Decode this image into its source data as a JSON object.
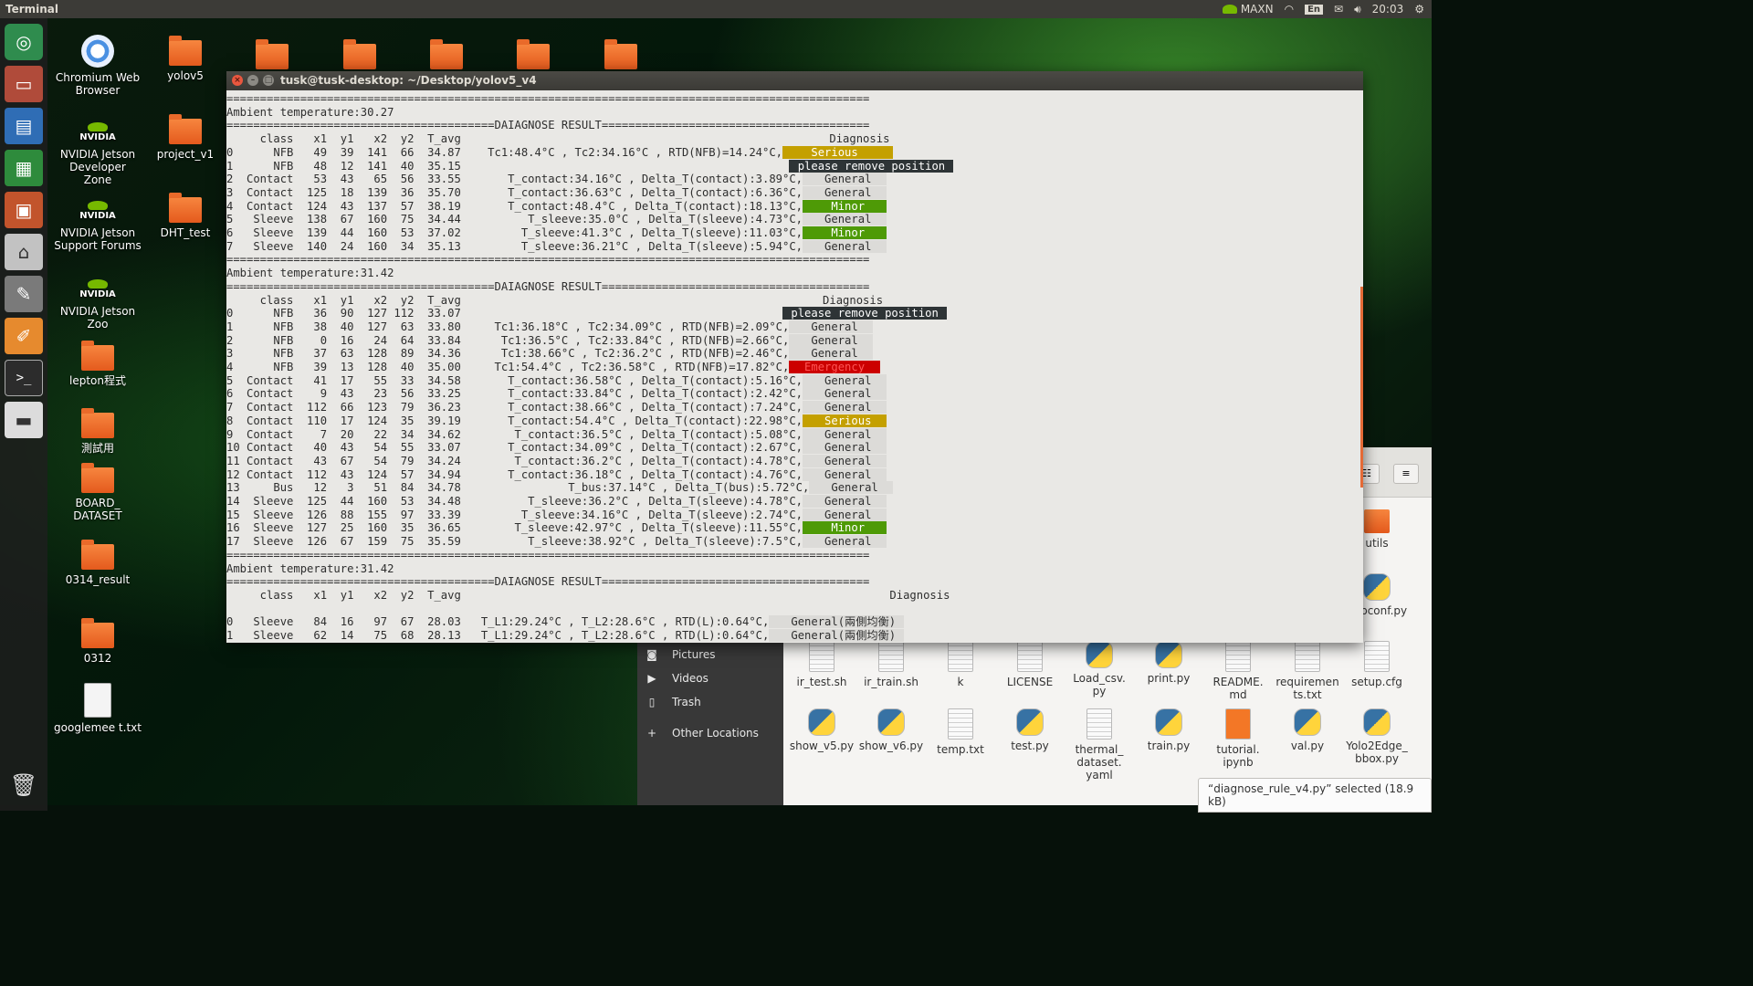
{
  "top_panel": {
    "app_title": "Terminal",
    "power_mode": "MAXN",
    "input_lang": "En",
    "clock": "20:03"
  },
  "launcher": {
    "items": [
      "ubuntu-logo",
      "files",
      "writer",
      "calc",
      "impress",
      "software-center",
      "settings",
      "text-editor",
      "terminal",
      "drive"
    ],
    "trash": "trash"
  },
  "desktop": {
    "icons": [
      {
        "label": "Chromium Web Browser",
        "kind": "chromium"
      },
      {
        "label": "yolov5",
        "kind": "folder"
      },
      {
        "label": "NVIDIA Jetson Developer Zone",
        "kind": "nvidia"
      },
      {
        "label": "project_v1",
        "kind": "folder"
      },
      {
        "label": "NVIDIA Jetson Support Forums",
        "kind": "nvidia"
      },
      {
        "label": "DHT_test",
        "kind": "folder"
      },
      {
        "label": "NVIDIA Jetson Zoo",
        "kind": "nvidia"
      },
      {
        "label": "lepton程式",
        "kind": "folder"
      },
      {
        "label": "測試用",
        "kind": "folder"
      },
      {
        "label": "BOARD_ DATASET",
        "kind": "folder"
      },
      {
        "label": "0314_result",
        "kind": "folder"
      },
      {
        "label": "0312",
        "kind": "folder"
      },
      {
        "label": "googlemee t.txt",
        "kind": "txt"
      }
    ]
  },
  "files_window": {
    "sidebar": [
      {
        "label": "Pictures",
        "icon": "camera-icon"
      },
      {
        "label": "Videos",
        "icon": "video-icon"
      },
      {
        "label": "Trash",
        "icon": "trash-icon"
      },
      {
        "label": "Other Locations",
        "icon": "plus-icon"
      }
    ],
    "items": [
      {
        "label": "utils",
        "type": "folder-sm"
      },
      {
        "label": "hubconf.py",
        "type": "py"
      },
      {
        "label": "ir_test.sh",
        "type": "txt"
      },
      {
        "label": "ir_train.sh",
        "type": "txt"
      },
      {
        "label": "k",
        "type": "txt"
      },
      {
        "label": "LICENSE",
        "type": "txt"
      },
      {
        "label": "Load_csv. py",
        "type": "py"
      },
      {
        "label": "print.py",
        "type": "py"
      },
      {
        "label": "README. md",
        "type": "txt"
      },
      {
        "label": "requiremen ts.txt",
        "type": "txt"
      },
      {
        "label": "setup.cfg",
        "type": "txt"
      },
      {
        "label": "show_v5.py",
        "type": "py"
      },
      {
        "label": "show_v6.py",
        "type": "py"
      },
      {
        "label": "temp.txt",
        "type": "txt"
      },
      {
        "label": "test.py",
        "type": "py"
      },
      {
        "label": "thermal_ dataset. yaml",
        "type": "txt"
      },
      {
        "label": "train.py",
        "type": "py"
      },
      {
        "label": "tutorial. ipynb",
        "type": "nb"
      },
      {
        "label": "val.py",
        "type": "py"
      },
      {
        "label": "Yolo2Edge_ bbox.py",
        "type": "py"
      }
    ],
    "status": "“diagnose_rule_v4.py” selected  (18.9 kB)"
  },
  "terminal": {
    "title": "tusk@tusk-desktop: ~/Desktop/yolov5_v4",
    "lines": [
      {
        "text": "================================================================================================"
      },
      {
        "text": "Ambient temperature:30.27"
      },
      {
        "text": "========================================DAIAGNOSE RESULT========================================"
      },
      {
        "text": "     class   x1  y1   x2  y2  T_avg                                                       Diagnosis"
      },
      {
        "text": "0      NFB   49  39  141  66  34.87    Tc1:48.4°C , Tc2:34.16°C , RTD(NFB)=14.24°C,",
        "tag": "    Serious     ",
        "tag_class": "serious"
      },
      {
        "text": "1      NFB   48  12  141  40  35.15                                                 ",
        "tag": " please remove position ",
        "tag_class": "note"
      },
      {
        "text": "2  Contact   53  43   65  56  33.55       T_contact:34.16°C , Delta_T(contact):3.89°C,",
        "tag": "   General  ",
        "tag_class": "general"
      },
      {
        "text": "3  Contact  125  18  139  36  35.70       T_contact:36.63°C , Delta_T(contact):6.36°C,",
        "tag": "   General  ",
        "tag_class": "general"
      },
      {
        "text": "4  Contact  124  43  137  57  38.19       T_contact:48.4°C , Delta_T(contact):18.13°C,",
        "tag": "    Minor   ",
        "tag_class": "minor"
      },
      {
        "text": "5   Sleeve  138  67  160  75  34.44          T_sleeve:35.0°C , Delta_T(sleeve):4.73°C,",
        "tag": "   General  ",
        "tag_class": "general"
      },
      {
        "text": "6   Sleeve  139  44  160  53  37.02         T_sleeve:41.3°C , Delta_T(sleeve):11.03°C,",
        "tag": "    Minor   ",
        "tag_class": "minor"
      },
      {
        "text": "7   Sleeve  140  24  160  34  35.13         T_sleeve:36.21°C , Delta_T(sleeve):5.94°C,",
        "tag": "   General  ",
        "tag_class": "general"
      },
      {
        "text": "================================================================================================"
      },
      {
        "text": "Ambient temperature:31.42"
      },
      {
        "text": "========================================DAIAGNOSE RESULT========================================"
      },
      {
        "text": "     class   x1  y1   x2  y2  T_avg                                                      Diagnosis"
      },
      {
        "text": "0      NFB   36  90  127 112  33.07                                                ",
        "tag": " please remove position ",
        "tag_class": "note"
      },
      {
        "text": "1      NFB   38  40  127  63  33.80     Tc1:36.18°C , Tc2:34.09°C , RTD(NFB)=2.09°C,",
        "tag": "   General  ",
        "tag_class": "general"
      },
      {
        "text": "2      NFB    0  16   24  64  33.84      Tc1:36.5°C , Tc2:33.84°C , RTD(NFB)=2.66°C,",
        "tag": "   General  ",
        "tag_class": "general"
      },
      {
        "text": "3      NFB   37  63  128  89  34.36      Tc1:38.66°C , Tc2:36.2°C , RTD(NFB)=2.46°C,",
        "tag": "   General  ",
        "tag_class": "general"
      },
      {
        "text": "4      NFB   39  13  128  40  35.00     Tc1:54.4°C , Tc2:36.58°C , RTD(NFB)=17.82°C,",
        "tag": "  Emergency  ",
        "tag_class": "emergency"
      },
      {
        "text": "5  Contact   41  17   55  33  34.58       T_contact:36.58°C , Delta_T(contact):5.16°C,",
        "tag": "   General  ",
        "tag_class": "general"
      },
      {
        "text": "6  Contact    9  43   23  56  33.25       T_contact:33.84°C , Delta_T(contact):2.42°C,",
        "tag": "   General  ",
        "tag_class": "general"
      },
      {
        "text": "7  Contact  112  66  123  79  36.23       T_contact:38.66°C , Delta_T(contact):7.24°C,",
        "tag": "   General  ",
        "tag_class": "general"
      },
      {
        "text": "8  Contact  110  17  124  35  39.19       T_contact:54.4°C , Delta_T(contact):22.98°C,",
        "tag": "   Serious  ",
        "tag_class": "serious"
      },
      {
        "text": "9  Contact    7  20   22  34  34.62        T_contact:36.5°C , Delta_T(contact):5.08°C,",
        "tag": "   General  ",
        "tag_class": "general"
      },
      {
        "text": "10 Contact   40  43   54  55  33.07       T_contact:34.09°C , Delta_T(contact):2.67°C,",
        "tag": "   General  ",
        "tag_class": "general"
      },
      {
        "text": "11 Contact   43  67   54  79  34.24        T_contact:36.2°C , Delta_T(contact):4.78°C,",
        "tag": "   General  ",
        "tag_class": "general"
      },
      {
        "text": "12 Contact  112  43  124  57  34.94       T_contact:36.18°C , Delta_T(contact):4.76°C,",
        "tag": "   General  ",
        "tag_class": "general"
      },
      {
        "text": "13     Bus   12   3   51  84  34.78                T_bus:37.14°C , Delta_T(bus):5.72°C,",
        "tag": "   General  ",
        "tag_class": "general"
      },
      {
        "text": "14  Sleeve  125  44  160  53  34.48          T_sleeve:36.2°C , Delta_T(sleeve):4.78°C,",
        "tag": "   General  ",
        "tag_class": "general"
      },
      {
        "text": "15  Sleeve  126  88  155  97  33.39         T_sleeve:34.16°C , Delta_T(sleeve):2.74°C,",
        "tag": "   General  ",
        "tag_class": "general"
      },
      {
        "text": "16  Sleeve  127  25  160  35  36.65        T_sleeve:42.97°C , Delta_T(sleeve):11.55°C,",
        "tag": "    Minor   ",
        "tag_class": "minor"
      },
      {
        "text": "17  Sleeve  126  67  159  75  35.59          T_sleeve:38.92°C , Delta_T(sleeve):7.5°C,",
        "tag": "   General  ",
        "tag_class": "general"
      },
      {
        "text": "================================================================================================"
      },
      {
        "text": "Ambient temperature:31.42"
      },
      {
        "text": "========================================DAIAGNOSE RESULT========================================"
      },
      {
        "text": "     class   x1  y1   x2  y2  T_avg                                                                Diagnosis"
      },
      {
        "text": ""
      },
      {
        "text": "0   Sleeve   84  16   97  67  28.03   T_L1:29.24°C , T_L2:28.6°C , RTD(L):0.64°C,",
        "tag": "   General(兩側均衡) ",
        "tag_class": "general"
      },
      {
        "text": "1   Sleeve   62  14   75  68  28.13   T_L1:29.24°C , T_L2:28.6°C , RTD(L):0.64°C,",
        "tag": "   General(兩側均衡) ",
        "tag_class": "general"
      }
    ]
  }
}
